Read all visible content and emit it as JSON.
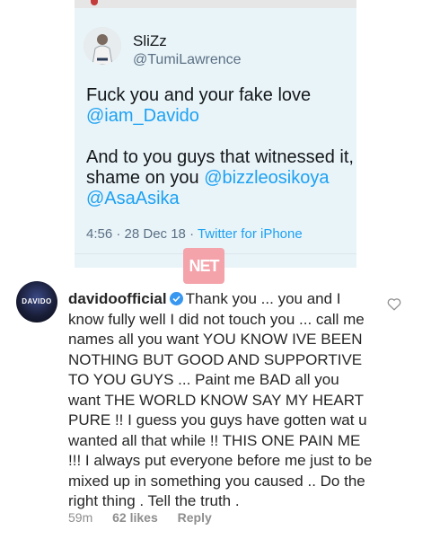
{
  "tweet": {
    "display_name": "SliZz",
    "handle": "@TumiLawrence",
    "line1": "Fuck you and your fake love",
    "mention1": "@iam_Davido",
    "line2": "And to you guys that witnessed it, shame on you",
    "mention2": "@bizzleosikoya",
    "mention3": "@AsaAsika",
    "time": "4:56 · 28 Dec 18 · ",
    "source": "Twitter for iPhone"
  },
  "watermark": "NET",
  "comment": {
    "username": "davidoofficial",
    "avatar_text": "DAVIDO",
    "text": "Thank you ... you and I know fully well I did not touch you ... call me names all you want YOU KNOW IVE BEEN NOTHING BUT GOOD AND SUPPORTIVE TO YOU GUYS ... Paint me BAD all you want THE WORLD KNOW SAY MY HEART PURE !! I guess you guys have gotten wat u wanted all that while !! THIS ONE PAIN ME !!! I always put everyone before me just to be mixed up in something you caused .. Do the right thing . Tell the truth .",
    "age": "59m",
    "likes": "62 likes",
    "reply": "Reply"
  },
  "colors": {
    "tweet_bg": "#e9f4f9",
    "link_blue": "#1da1f2",
    "verified_blue": "#3897f0",
    "meta_gray": "#8e8e8e"
  }
}
